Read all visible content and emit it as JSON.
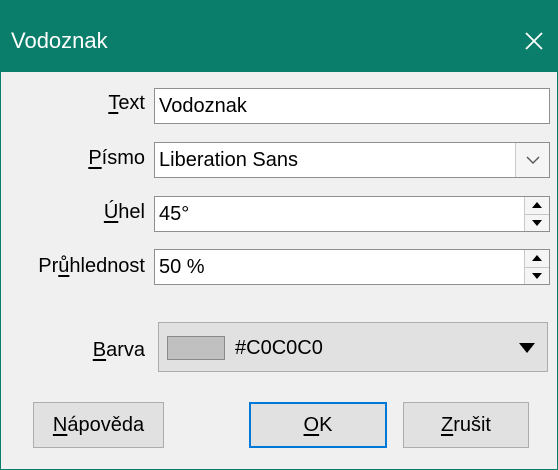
{
  "window": {
    "title": "Vodoznak",
    "close_glyph": "✕"
  },
  "form": {
    "text": {
      "label_u": "T",
      "label_rest": "ext",
      "value": "Vodoznak"
    },
    "font": {
      "label_u": "P",
      "label_rest": "ísmo",
      "value": "Liberation Sans"
    },
    "angle": {
      "label_pre": "",
      "label_u": "Ú",
      "label_rest": "hel",
      "value": "45°"
    },
    "transparency": {
      "label_pre": "Pr",
      "label_u": "ů",
      "label_rest": "hlednost",
      "value": "50 %"
    },
    "color": {
      "label_u": "B",
      "label_rest": "arva",
      "value": "#C0C0C0",
      "swatch": "#c0c0c0"
    }
  },
  "buttons": {
    "help": {
      "u": "N",
      "rest": "ápověda"
    },
    "ok": {
      "u": "O",
      "rest": "K"
    },
    "cancel": {
      "u": "Z",
      "rest": "rušit"
    }
  },
  "colors": {
    "titlebar": "#0a7e6a",
    "focus_border": "#0078d7"
  },
  "icons": [
    "close-icon",
    "chevron-down-icon",
    "spin-up-icon",
    "spin-down-icon",
    "dropdown-arrow-icon"
  ]
}
